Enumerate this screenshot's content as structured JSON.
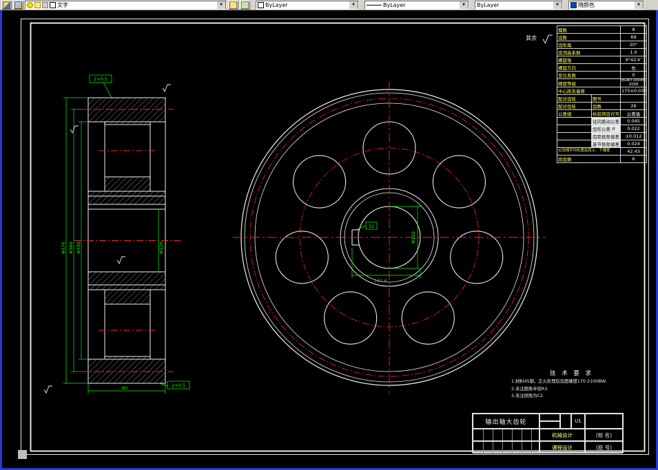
{
  "toolbar": {
    "layer": {
      "value": "文字"
    },
    "color": {
      "value": "ByLayer"
    },
    "linetype": {
      "value": "ByLayer"
    },
    "lineweight": {
      "value": "ByLayer"
    },
    "plot_style": {
      "value": "随颜色"
    }
  },
  "drawing": {
    "surface_note": {
      "prefix": "其余"
    },
    "left_view": {
      "dim_outer": "Φ576",
      "dim_pitch": "Φ560",
      "dim_rim": "Φ490",
      "dim_bore": "Φ120",
      "dim_width": "80",
      "chamfer_top": "2×0.5",
      "chamfer_bottom": "2×0.5"
    },
    "front_view": {
      "dim_bore": "Φ120",
      "dim_keyway_width": "32",
      "dim_keyway_depth": "127.4"
    },
    "param_table": {
      "rows": [
        [
          "模数",
          "8"
        ],
        [
          "齿数",
          "69"
        ],
        [
          "齿形角",
          "20°"
        ],
        [
          "齿顶高系数",
          "1.0"
        ],
        [
          "螺旋角",
          "9°42′4″"
        ],
        [
          "螺旋方向",
          "右"
        ],
        [
          "变位系数",
          "0"
        ],
        [
          "精度等级",
          "8GB/T10095.1-2008"
        ],
        [
          "中心距及偏差",
          "175±0.032"
        ],
        [
          "配对齿轮",
          "图号",
          ""
        ],
        [
          "配对齿轮",
          "齿数",
          "26"
        ],
        [
          "公差组",
          "检验项目代号",
          "公差值"
        ],
        [
          "",
          "径向跳动公差 Fr",
          "0.045"
        ],
        [
          "",
          "齿形公差 ff",
          "0.022"
        ],
        [
          "",
          "齿距极限偏差 fpt",
          "±0.012"
        ],
        [
          "",
          "基节极限偏差 fpb",
          "0.024"
        ],
        [
          "公法线平均长度及其上、下偏差",
          "42.43"
        ],
        [
          "跨齿数",
          "6"
        ]
      ]
    },
    "tech_req": {
      "title": "技 术 要 求",
      "items": [
        "1.材料45钢，正火处理后齿面硬度170-210HBW.",
        "2.未注圆角半径R3.",
        "3.未注倒角为C2."
      ]
    },
    "title_block": {
      "part_name": "输出轴大齿轮",
      "code": "U1",
      "row1_label": "机械设计",
      "row2_label": "课程设计",
      "school": "(校 名)",
      "class_no": "(班 号)"
    }
  }
}
